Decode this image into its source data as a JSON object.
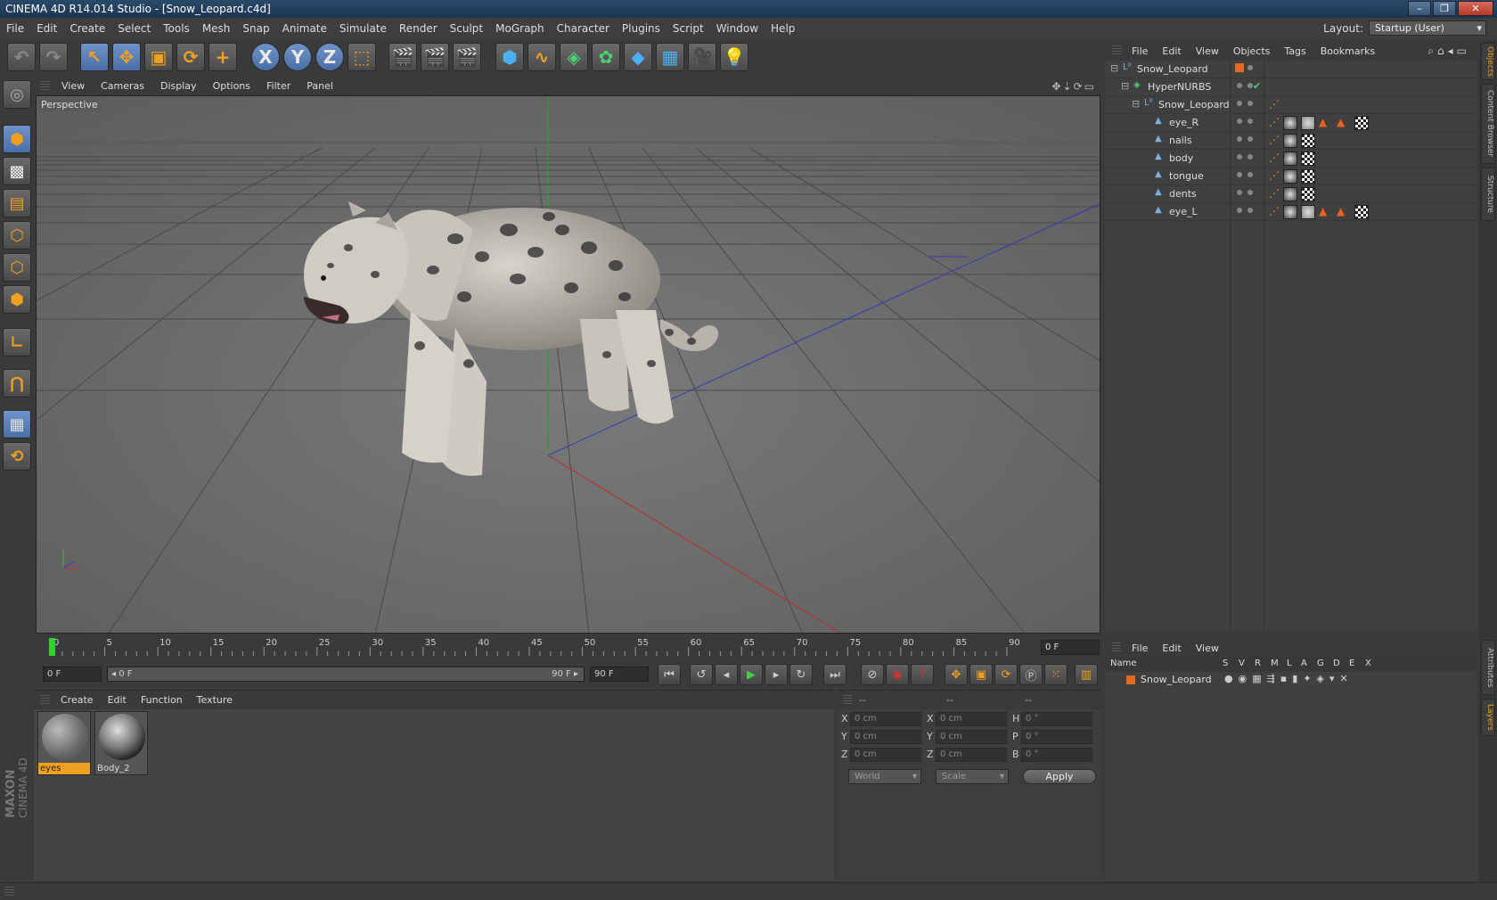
{
  "window": {
    "title": "CINEMA 4D R14.014 Studio - [Snow_Leopard.c4d]"
  },
  "menubar": [
    "File",
    "Edit",
    "Create",
    "Select",
    "Tools",
    "Mesh",
    "Snap",
    "Animate",
    "Simulate",
    "Render",
    "Sculpt",
    "MoGraph",
    "Character",
    "Plugins",
    "Script",
    "Window",
    "Help"
  ],
  "layout": {
    "label": "Layout:",
    "value": "Startup (User)"
  },
  "toolbar": {
    "undo": "↶",
    "redo": "↷",
    "tools": [
      {
        "name": "live-selection-icon",
        "glyph": "↖"
      },
      {
        "name": "move-icon",
        "glyph": "✥"
      },
      {
        "name": "scale-icon",
        "glyph": "▣"
      },
      {
        "name": "rotate-icon",
        "glyph": "⟳"
      },
      {
        "name": "add-icon",
        "glyph": "+"
      }
    ],
    "axes": [
      "X",
      "Y",
      "Z"
    ]
  },
  "viewport": {
    "menu": [
      "View",
      "Cameras",
      "Display",
      "Options",
      "Filter",
      "Panel"
    ],
    "label": "Perspective"
  },
  "timeline": {
    "ticks": [
      "0",
      "5",
      "10",
      "15",
      "20",
      "25",
      "30",
      "35",
      "40",
      "45",
      "50",
      "55",
      "60",
      "65",
      "70",
      "75",
      "80",
      "85",
      "90"
    ],
    "current_frame": "0 F",
    "start": "0 F",
    "range_start": "◂ 0 F",
    "range_end": "90 F ▸",
    "end": "90 F"
  },
  "materials": {
    "menu": [
      "Create",
      "Edit",
      "Function",
      "Texture"
    ],
    "items": [
      {
        "label": "eyes"
      },
      {
        "label": "Body_2"
      }
    ]
  },
  "coordinates": {
    "head": [
      "--",
      "--",
      "--"
    ],
    "rows": [
      {
        "a": "X",
        "av": "0 cm",
        "b": "X",
        "bv": "0 cm",
        "c": "H",
        "cv": "0 °"
      },
      {
        "a": "Y",
        "av": "0 cm",
        "b": "Y",
        "bv": "0 cm",
        "c": "P",
        "cv": "0 °"
      },
      {
        "a": "Z",
        "av": "0 cm",
        "b": "Z",
        "bv": "0 cm",
        "c": "B",
        "cv": "0 °"
      }
    ],
    "world": "World",
    "scale": "Scale",
    "apply": "Apply"
  },
  "objects": {
    "menu": [
      "File",
      "Edit",
      "View",
      "Objects",
      "Tags",
      "Bookmarks"
    ],
    "items": [
      {
        "name": "Snow_Leopard",
        "level": 0
      },
      {
        "name": "HyperNURBS",
        "level": 1
      },
      {
        "name": "Snow_Leopard",
        "level": 2
      },
      {
        "name": "eye_R",
        "level": 3
      },
      {
        "name": "nails",
        "level": 3
      },
      {
        "name": "body",
        "level": 3
      },
      {
        "name": "tongue",
        "level": 3
      },
      {
        "name": "dents",
        "level": 3
      },
      {
        "name": "eye_L",
        "level": 3
      }
    ]
  },
  "layers": {
    "menu": [
      "File",
      "Edit",
      "View"
    ],
    "columns": [
      "Name",
      "S",
      "V",
      "R",
      "M",
      "L",
      "A",
      "G",
      "D",
      "E",
      "X"
    ],
    "items": [
      {
        "name": "Snow_Leopard",
        "color": "#e06a20"
      }
    ]
  },
  "sidetabs": [
    "Objects",
    "Content Browser",
    "Structure",
    "Attributes",
    "Layers"
  ],
  "brand": {
    "maxon": "MAXON",
    "cinema": "CINEMA 4D"
  },
  "colors": {
    "accent": "#f0a020",
    "selection": "#5a7fb8",
    "x_axis": "#c03030",
    "y_axis": "#30c030",
    "z_axis": "#3040c0"
  }
}
